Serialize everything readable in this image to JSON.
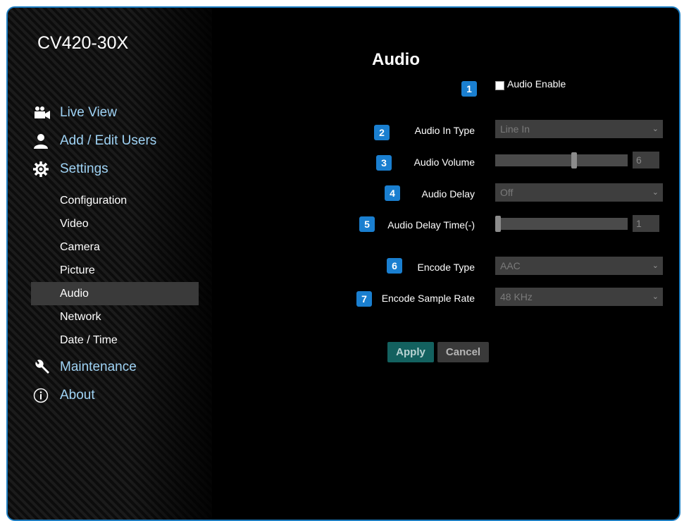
{
  "brand": "CV420-30X",
  "nav": {
    "main": [
      {
        "label": "Live View",
        "icon": "camera-icon"
      },
      {
        "label": "Add / Edit Users",
        "icon": "user-icon"
      },
      {
        "label": "Settings",
        "icon": "gear-icon"
      },
      {
        "label": "Maintenance",
        "icon": "wrench-icon"
      },
      {
        "label": "About",
        "icon": "info-icon"
      }
    ],
    "settings_sub": [
      "Configuration",
      "Video",
      "Camera",
      "Picture",
      "Audio",
      "Network",
      "Date / Time"
    ],
    "active_sub": "Audio"
  },
  "page": {
    "title": "Audio",
    "badges": [
      "1",
      "2",
      "3",
      "4",
      "5",
      "6",
      "7"
    ],
    "audio_enable": {
      "label": "Audio Enable",
      "checked": false
    },
    "audio_in_type": {
      "label": "Audio In Type",
      "value": "Line In"
    },
    "audio_volume": {
      "label": "Audio Volume",
      "value": "6",
      "fraction": 0.6
    },
    "audio_delay": {
      "label": "Audio Delay",
      "value": "Off"
    },
    "audio_delay_time": {
      "label": "Audio Delay Time(-)",
      "value": "1",
      "fraction": 0.0
    },
    "encode_type": {
      "label": "Encode Type",
      "value": "AAC"
    },
    "encode_sample_rate": {
      "label": "Encode Sample Rate",
      "value": "48 KHz"
    },
    "apply_label": "Apply",
    "cancel_label": "Cancel"
  },
  "colors": {
    "frame_border": "#1e7fc3",
    "nav_main_text": "#9fd3f5",
    "badge": "#1a7fd0",
    "apply_button": "#13615f"
  }
}
